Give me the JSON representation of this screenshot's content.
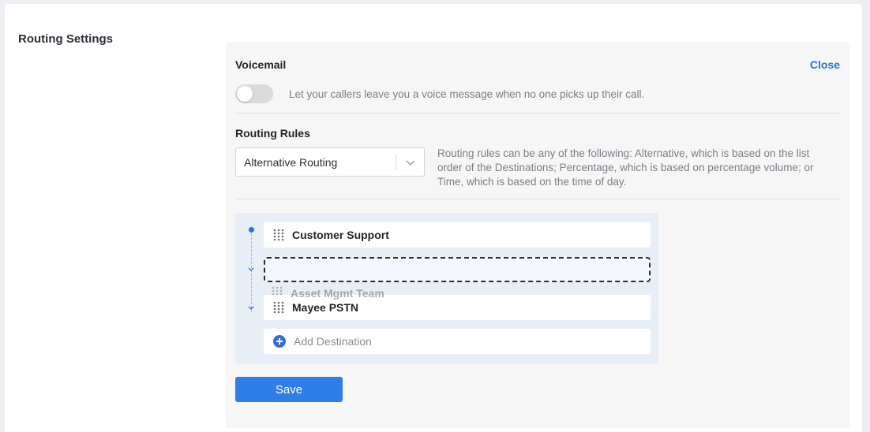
{
  "page": {
    "section_title": "Routing Settings"
  },
  "voicemail": {
    "title": "Voicemail",
    "close_label": "Close",
    "toggle_on": false,
    "description": "Let your callers leave you a voice message when no one picks up their call."
  },
  "routing_rules": {
    "title": "Routing Rules",
    "selected": "Alternative Routing",
    "description": "Routing rules can be any of the following: Alternative, which is based on the list order of the Destinations; Percentage, which is based on percentage volume; or Time, which is based on the time of day."
  },
  "destinations": {
    "items": [
      {
        "name": "Customer Support"
      },
      {
        "name": "Mayee PSTN"
      }
    ],
    "dragging_item": "Asset Mgmt Team",
    "add_label": "Add Destination"
  },
  "actions": {
    "save_label": "Save"
  },
  "colors": {
    "accent": "#2f6fd6",
    "button": "#2f7de6",
    "destinations_bg": "#e8eef6"
  },
  "icons": {
    "grip": "drag-handle-icon",
    "chevron": "chevron-down-icon",
    "add": "plus-circle-icon"
  }
}
